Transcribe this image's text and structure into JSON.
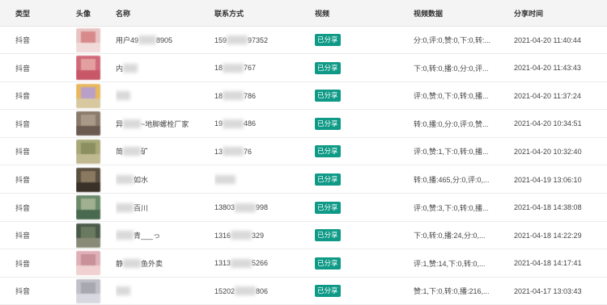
{
  "headers": {
    "type": "类型",
    "avatar": "头像",
    "name": "名称",
    "contact": "联系方式",
    "video": "视频",
    "stats": "视频数据",
    "time": "分享时间"
  },
  "rows": [
    {
      "type": "抖音",
      "name_a": "用户49",
      "name_b": "8905",
      "contact_a": "159",
      "contact_b": "97352",
      "video": "已分享",
      "stats": "分:0,评:0,赞:0,下:0,转:...",
      "time": "2021-04-20 11:40:44",
      "avatar_colors": [
        "#e8c4c4",
        "#d88a8a",
        "#f0dada"
      ]
    },
    {
      "type": "抖音",
      "name_a": "内",
      "name_b": "",
      "contact_a": "18",
      "contact_b": "767",
      "video": "已分享",
      "stats": "下:0,转:0,播:0,分:0,评...",
      "time": "2021-04-20 11:43:43",
      "avatar_colors": [
        "#d06a7a",
        "#e4a0a0",
        "#c85868"
      ]
    },
    {
      "type": "抖音",
      "name_a": "",
      "name_b": "",
      "contact_a": "18",
      "contact_b": "786",
      "video": "已分享",
      "stats": "评:0,赞:0,下:0,转:0,播...",
      "time": "2021-04-20 11:37:24",
      "avatar_colors": [
        "#e8b860",
        "#b8a0c8",
        "#d8c8a0"
      ]
    },
    {
      "type": "抖音",
      "name_a": "异",
      "name_b": "~地脚螺栓厂家",
      "contact_a": "19",
      "contact_b": "486",
      "video": "已分享",
      "stats": "转:0,播:0,分:0,评:0,赞...",
      "time": "2021-04-20 10:34:51",
      "avatar_colors": [
        "#8a7a6a",
        "#a89888",
        "#6a5a50"
      ]
    },
    {
      "type": "抖音",
      "name_a": "简",
      "name_b": "矿",
      "contact_a": "13",
      "contact_b": "76",
      "video": "已分享",
      "stats": "评:0,赞:1,下:0,转:0,播...",
      "time": "2021-04-20 10:32:40",
      "avatar_colors": [
        "#a8a878",
        "#8a9060",
        "#c0b890"
      ]
    },
    {
      "type": "抖音",
      "name_a": "",
      "name_b": "如水",
      "contact_a": "",
      "contact_b": "",
      "video": "已分享",
      "stats": "转:0,播:465,分:0,评:0,...",
      "time": "2021-04-19 13:06:10",
      "avatar_colors": [
        "#5a5040",
        "#8a7860",
        "#3a3228"
      ]
    },
    {
      "type": "抖音",
      "name_a": "",
      "name_b": "百川",
      "contact_a": "13803",
      "contact_b": "998",
      "video": "已分享",
      "stats": "评:0,赞:3,下:0,转:0,播...",
      "time": "2021-04-18 14:38:08",
      "avatar_colors": [
        "#6a8a6a",
        "#a0b090",
        "#4a6a50"
      ]
    },
    {
      "type": "抖音",
      "name_a": "",
      "name_b": "青___っ",
      "contact_a": "1316",
      "contact_b": "329",
      "video": "已分享",
      "stats": "下:0,转:0,播:24,分:0,...",
      "time": "2021-04-18 14:22:29",
      "avatar_colors": [
        "#4a5a4a",
        "#6a7a60",
        "#8a8a78"
      ]
    },
    {
      "type": "抖音",
      "name_a": "静",
      "name_b": "鱼外卖",
      "contact_a": "1313",
      "contact_b": "5266",
      "video": "已分享",
      "stats": "评:1,赞:14,下:0,转:0,...",
      "time": "2021-04-18 14:17:41",
      "avatar_colors": [
        "#e0b0b8",
        "#c89098",
        "#f0d0d0"
      ]
    },
    {
      "type": "抖音",
      "name_a": "",
      "name_b": "",
      "contact_a": "15202",
      "contact_b": "806",
      "video": "已分享",
      "stats": "赞:1,下:0,转:0,播:216,...",
      "time": "2021-04-17 13:03:43",
      "avatar_colors": [
        "#c0c0c8",
        "#a8a8b0",
        "#d8d8e0"
      ]
    }
  ]
}
